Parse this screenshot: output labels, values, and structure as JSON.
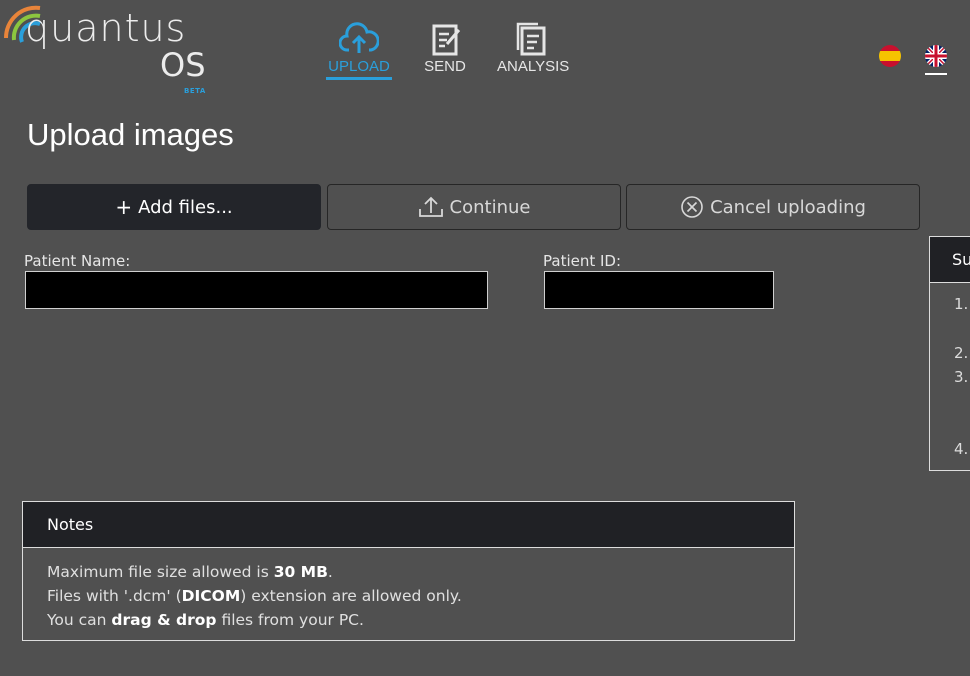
{
  "logo": {
    "word": "quantus",
    "os": "OS",
    "beta": "BETA"
  },
  "nav": [
    {
      "label": "UPLOAD",
      "icon": "cloud-upload-icon",
      "active": true
    },
    {
      "label": "SEND",
      "icon": "send-document-icon",
      "active": false
    },
    {
      "label": "ANALYSIS",
      "icon": "analysis-document-icon",
      "active": false
    }
  ],
  "languages": [
    {
      "code": "es",
      "icon": "spain-flag-icon"
    },
    {
      "code": "en",
      "icon": "uk-flag-icon",
      "selected": true
    }
  ],
  "page_title": "Upload images",
  "toolbar": {
    "add_files": "Add files...",
    "continue": "Continue",
    "cancel": "Cancel uploading"
  },
  "form": {
    "patient_name_label": "Patient Name:",
    "patient_name_value": "",
    "patient_id_label": "Patient ID:",
    "patient_id_value": ""
  },
  "side_panel": {
    "title": "Su",
    "items": [
      "1.",
      "2.",
      "3.",
      "4."
    ]
  },
  "notes": {
    "title": "Notes",
    "line1_pre": "Maximum file size allowed is ",
    "line1_bold": "30 MB",
    "line1_post": ".",
    "line2_pre": "Files with '.dcm' (",
    "line2_bold": "DICOM",
    "line2_post": ") extension are allowed only.",
    "line3_pre": "You can ",
    "line3_bold": "drag & drop",
    "line3_post": " files from your PC."
  },
  "colors": {
    "background": "#505050",
    "accent": "#2a9fdb",
    "panel_header": "#202125",
    "button_primary": "#23252a"
  }
}
